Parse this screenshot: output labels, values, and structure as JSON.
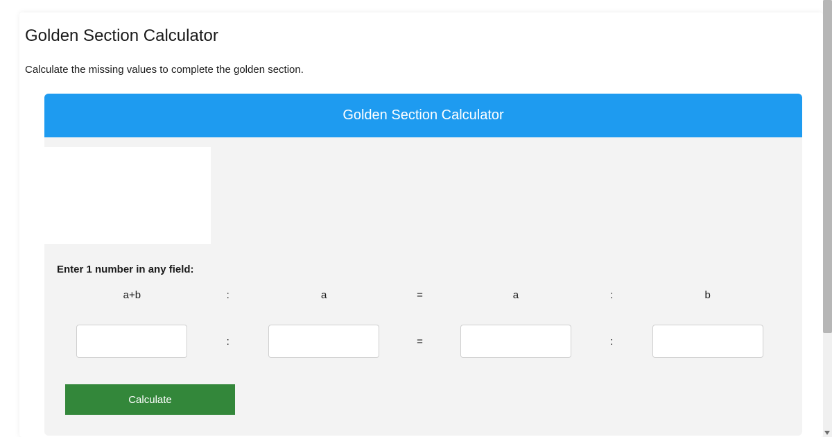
{
  "page": {
    "title": "Golden Section Calculator",
    "subtitle": "Calculate the missing values to complete the golden section."
  },
  "card": {
    "header": "Golden Section Calculator",
    "instructions": "Enter 1 number in any field:",
    "labels": {
      "aplusb": "a+b",
      "sep_colon": ":",
      "a1": "a",
      "sep_equals": "=",
      "a2": "a",
      "b": "b"
    },
    "inputs": {
      "aplusb": "",
      "a1": "",
      "a2": "",
      "b": ""
    },
    "separators": {
      "colon": ":",
      "equals": "="
    },
    "calculate_label": "Calculate"
  },
  "colors": {
    "header_blue": "#1e9bf0",
    "button_green": "#33873a",
    "card_bg": "#f3f3f3"
  }
}
